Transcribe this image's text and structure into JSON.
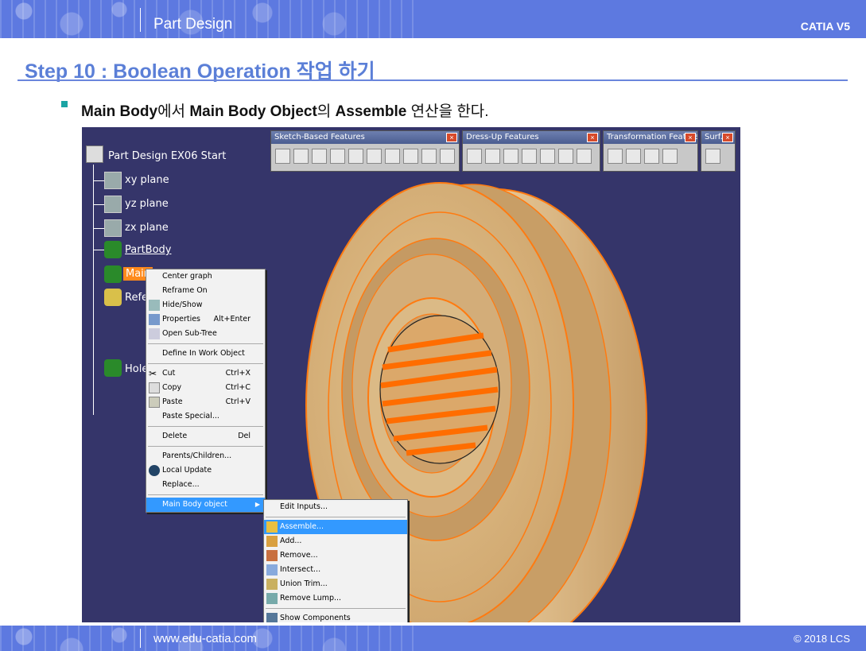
{
  "header": {
    "title": "Part Design",
    "product": "CATIA V5"
  },
  "step_title": "Step 10 : Boolean Operation 작업 하기",
  "instruction": {
    "part1": "Main Body",
    "part2": "에서 ",
    "part3": "Main Body Object",
    "part4": "의 ",
    "part5": "Assemble",
    "part6": " 연산을 한다."
  },
  "tree": {
    "root": "Part Design EX06 Start",
    "items": [
      "xy plane",
      "yz plane",
      "zx plane",
      "PartBody",
      "Main",
      "Refe",
      "Hole"
    ]
  },
  "toolbars": [
    {
      "title": "Sketch-Based Features"
    },
    {
      "title": "Dress-Up Features"
    },
    {
      "title": "Transformation Features"
    },
    {
      "title": "Surf..."
    }
  ],
  "context_menu": {
    "items": [
      {
        "label": "Center graph",
        "shortcut": ""
      },
      {
        "label": "Reframe On",
        "shortcut": ""
      },
      {
        "label": "Hide/Show",
        "shortcut": ""
      },
      {
        "label": "Properties",
        "shortcut": "Alt+Enter"
      },
      {
        "label": "Open Sub-Tree",
        "shortcut": ""
      },
      {
        "label": "Define In Work Object",
        "shortcut": ""
      },
      {
        "label": "Cut",
        "shortcut": "Ctrl+X"
      },
      {
        "label": "Copy",
        "shortcut": "Ctrl+C"
      },
      {
        "label": "Paste",
        "shortcut": "Ctrl+V"
      },
      {
        "label": "Paste Special...",
        "shortcut": ""
      },
      {
        "label": "Delete",
        "shortcut": "Del"
      },
      {
        "label": "Parents/Children...",
        "shortcut": ""
      },
      {
        "label": "Local Update",
        "shortcut": ""
      },
      {
        "label": "Replace...",
        "shortcut": ""
      },
      {
        "label": "Main Body object",
        "shortcut": ""
      }
    ]
  },
  "submenu": {
    "items": [
      "Edit Inputs...",
      "Assemble...",
      "Add...",
      "Remove...",
      "Intersect...",
      "Union Trim...",
      "Remove Lump...",
      "Show Components"
    ]
  },
  "footer": {
    "url": "www.edu-catia.com",
    "copyright": "© 2018 LCS"
  }
}
